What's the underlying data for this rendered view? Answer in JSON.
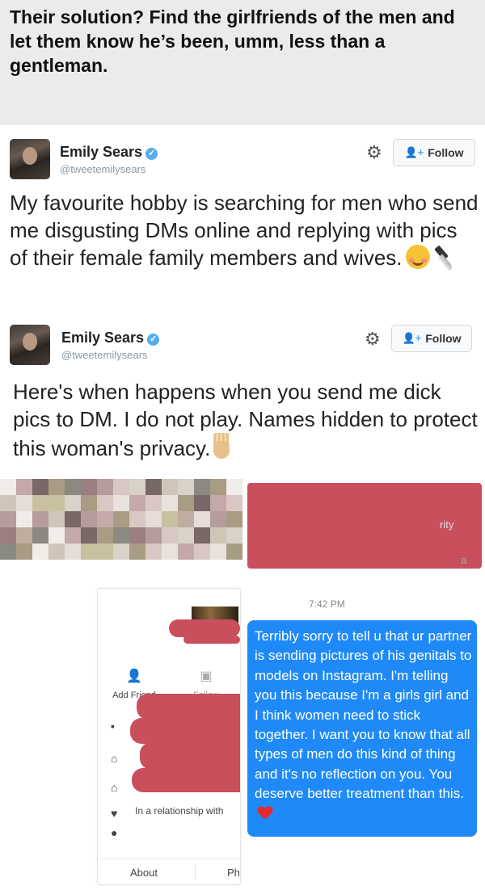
{
  "header": {
    "text": "Their solution? Find the girlfriends of the men and let them know he’s been, umm, less than a gentleman."
  },
  "tweets": [
    {
      "name": "Emily Sears",
      "handle": "@tweetemilysears",
      "follow_label": "Follow",
      "text": "My favourite hobby is searching for men who send me disgusting DMs online and replying with pics of their female family members and wives.",
      "emojis": [
        "smiling-face-emoji",
        "knife-emoji"
      ]
    },
    {
      "name": "Emily Sears",
      "handle": "@tweetemilysears",
      "follow_label": "Follow",
      "text": "Here's when happens when you send me dick pics to DM. I do not play. Names hidden to protect this woman's privacy.",
      "emojis": [
        "raised-hand-emoji"
      ]
    }
  ],
  "screenshot": {
    "partial_text_1": "rity",
    "partial_text_2": "a",
    "profile": {
      "add_friend": "Add Friend",
      "follow": "Follow",
      "relationship": "In a relationship with",
      "tab_about": "About",
      "tab_photos": "Ph"
    },
    "message": {
      "time": "7:42 PM",
      "text": "Terribly sorry to tell u that ur partner is sending pictures of his genitals to models on Instagram. I'm telling you this because I'm a girls girl and I think women need to stick together. I want you to know that all types of men do this kind of thing and it's no reflection on you. You deserve better treatment than this."
    }
  },
  "colors": {
    "redaction": "#c94f5c",
    "message_bubble": "#1f8af7",
    "verified": "#55acee",
    "header_bg": "#ebebeb"
  }
}
